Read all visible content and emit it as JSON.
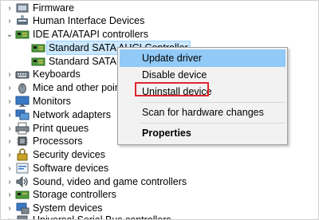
{
  "tree": [
    {
      "label": "Firmware",
      "icon": "firmware-icon",
      "expander": "›"
    },
    {
      "label": "Human Interface Devices",
      "icon": "hid-icon",
      "expander": "›"
    },
    {
      "label": "IDE ATA/ATAPI controllers",
      "icon": "ide-controller-icon",
      "expander": "⌄"
    },
    {
      "label": "Standard SATA AHCI Controller",
      "icon": "sata-controller-icon",
      "expander": ""
    },
    {
      "label": "Standard SATA AHCI Controller",
      "icon": "sata-controller-icon",
      "expander": ""
    },
    {
      "label": "Keyboards",
      "icon": "keyboard-icon",
      "expander": "›"
    },
    {
      "label": "Mice and other pointing devices",
      "icon": "mouse-icon",
      "expander": "›"
    },
    {
      "label": "Monitors",
      "icon": "monitor-icon",
      "expander": "›"
    },
    {
      "label": "Network adapters",
      "icon": "network-adapter-icon",
      "expander": "›"
    },
    {
      "label": "Print queues",
      "icon": "printer-icon",
      "expander": "›"
    },
    {
      "label": "Processors",
      "icon": "processor-icon",
      "expander": "›"
    },
    {
      "label": "Security devices",
      "icon": "security-device-icon",
      "expander": "›"
    },
    {
      "label": "Software devices",
      "icon": "software-device-icon",
      "expander": "›"
    },
    {
      "label": "Sound, video and game controllers",
      "icon": "sound-icon",
      "expander": "›"
    },
    {
      "label": "Storage controllers",
      "icon": "storage-controller-icon",
      "expander": "›"
    },
    {
      "label": "System devices",
      "icon": "system-device-icon",
      "expander": "›"
    },
    {
      "label": "Universal Serial Bus controllers",
      "icon": "usb-icon",
      "expander": "›"
    }
  ],
  "context_menu": {
    "update_driver": "Update driver",
    "disable_device": "Disable device",
    "uninstall_device": "Uninstall device",
    "scan_hardware": "Scan for hardware changes",
    "properties": "Properties"
  },
  "colors": {
    "highlight": "#91c9f7",
    "selection": "#cce8ff",
    "annotation_red": "#e0262d"
  }
}
